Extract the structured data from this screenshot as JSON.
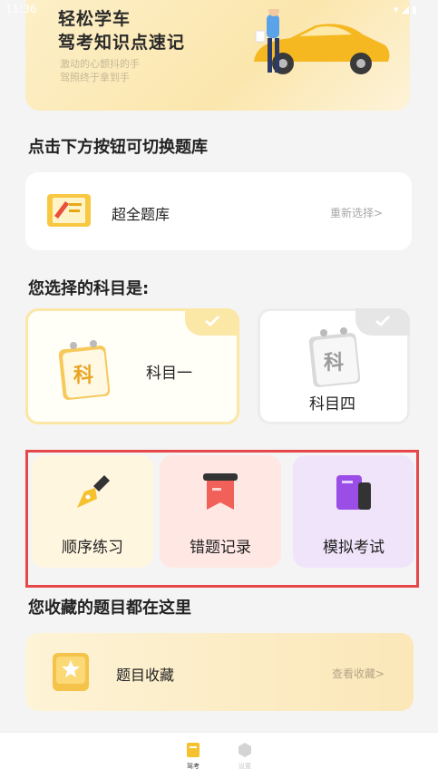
{
  "status_bar": {
    "time": "11:36",
    "icons": "wifi signal battery"
  },
  "banner": {
    "title_line1": "轻松学车",
    "title_line2": "驾考知识点速记",
    "sub_line1": "激动的心颤抖的手",
    "sub_line2": "驾照终于拿到手"
  },
  "question_bank": {
    "heading": "点击下方按钮可切换题库",
    "name": "超全题库",
    "reselect": "重新选择>"
  },
  "subjects": {
    "heading": "您选择的科目是:",
    "calendar_char": "科",
    "items": [
      {
        "label": "科目一",
        "selected": true
      },
      {
        "label": "科目四",
        "selected": false
      }
    ]
  },
  "features": [
    {
      "label": "顺序练习",
      "icon": "pen-nib-icon"
    },
    {
      "label": "错题记录",
      "icon": "bookmark-icon"
    },
    {
      "label": "模拟考试",
      "icon": "exam-book-icon"
    }
  ],
  "favorites": {
    "heading": "您收藏的题目都在这里",
    "label": "题目收藏",
    "view": "查看收藏>"
  },
  "bottom_nav": [
    {
      "label": "驾考",
      "active": true
    },
    {
      "label": "设置",
      "active": false
    }
  ],
  "colors": {
    "accent_yellow": "#fbe7a6",
    "highlight_red": "#e5474b",
    "feature1_bg": "#fff6e0",
    "feature2_bg": "#ffe7e4",
    "feature3_bg": "#f0e4fb"
  }
}
